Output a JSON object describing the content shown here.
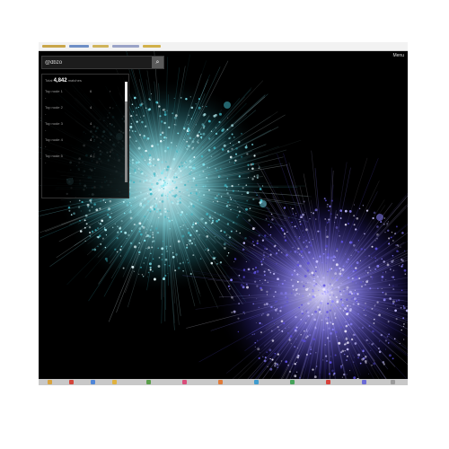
{
  "search": {
    "value": "@dbzo",
    "button_icon": "search-icon"
  },
  "panel": {
    "prefix": "Total",
    "count": "4,842",
    "suffix": "matches",
    "rows": [
      {
        "label": "Top node 1",
        "sub": "-",
        "value": "6",
        "mark": "›"
      },
      {
        "label": "Top node 2",
        "sub": "-",
        "value": "4",
        "mark": "›"
      },
      {
        "label": "Top node 3",
        "sub": "-",
        "value": "4",
        "mark": "›"
      },
      {
        "label": "Top node 4",
        "sub": "-",
        "value": "4",
        "mark": "›"
      },
      {
        "label": "Top node 5",
        "sub": "-",
        "value": "4",
        "mark": "›"
      }
    ]
  },
  "corner": {
    "label": "Menu"
  },
  "colors": {
    "cluster_left": "#7fe3ee",
    "cluster_right": "#8d84ff",
    "background": "#000000"
  }
}
